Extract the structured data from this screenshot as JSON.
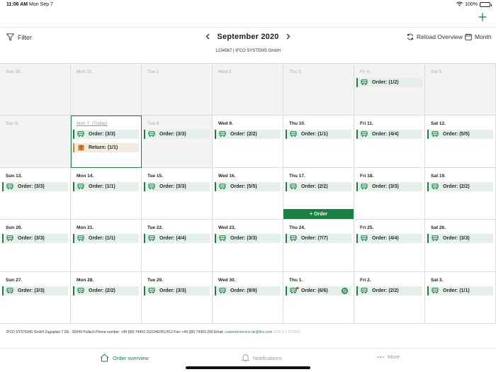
{
  "status_bar": {
    "time": "11:06 AM",
    "date": "Mon Sep 7",
    "battery": "100%"
  },
  "toolbar": {
    "filter_label": "Filter",
    "month_title": "September 2020",
    "customer": "1234567 | IFCO SYSTEMS GmbH",
    "reload_label": "Reload Overview",
    "view_label": "Month"
  },
  "calendar": {
    "cells": [
      {
        "label": "Sun 30.",
        "state": "past",
        "chips": []
      },
      {
        "label": "Mon 31.",
        "state": "past",
        "chips": []
      },
      {
        "label": "Tue 1.",
        "state": "past",
        "chips": []
      },
      {
        "label": "Wed 2.",
        "state": "past",
        "chips": []
      },
      {
        "label": "Thu 3.",
        "state": "past",
        "chips": []
      },
      {
        "label": "Fri 4.",
        "state": "past",
        "chips": [
          {
            "type": "order",
            "text": "Order: (1/2)"
          }
        ]
      },
      {
        "label": "Sat 5.",
        "state": "past",
        "chips": []
      },
      {
        "label": "Sun 6.",
        "state": "past",
        "chips": []
      },
      {
        "label": "Mon 7. (Today)",
        "state": "today",
        "chips": [
          {
            "type": "order",
            "text": "Order: (3/3)"
          },
          {
            "type": "return",
            "text": "Return: (1/1)"
          }
        ]
      },
      {
        "label": "Tue 8.",
        "state": "past",
        "chips": [
          {
            "type": "order",
            "text": "Order: (3/3)"
          }
        ]
      },
      {
        "label": "Wed 9.",
        "state": "",
        "chips": [
          {
            "type": "order",
            "text": "Order: (2/2)"
          }
        ]
      },
      {
        "label": "Thu 10.",
        "state": "",
        "chips": [
          {
            "type": "order",
            "text": "Order: (1/1)"
          }
        ]
      },
      {
        "label": "Fri 11.",
        "state": "",
        "chips": [
          {
            "type": "order",
            "text": "Order: (4/4)"
          }
        ]
      },
      {
        "label": "Sat 12.",
        "state": "",
        "chips": [
          {
            "type": "order",
            "text": "Order: (5/5)"
          }
        ]
      },
      {
        "label": "Sun 13.",
        "state": "",
        "chips": [
          {
            "type": "order",
            "text": "Order: (3/3)"
          }
        ]
      },
      {
        "label": "Mon 14.",
        "state": "",
        "chips": [
          {
            "type": "order",
            "text": "Order: (1/1)"
          }
        ]
      },
      {
        "label": "Tue 15.",
        "state": "",
        "chips": [
          {
            "type": "order",
            "text": "Order: (3/3)"
          }
        ]
      },
      {
        "label": "Wed 16.",
        "state": "",
        "chips": [
          {
            "type": "order",
            "text": "Order: (5/5)"
          }
        ]
      },
      {
        "label": "Thu 17.",
        "state": "",
        "chips": [
          {
            "type": "order",
            "text": "Order: (2/2)"
          }
        ],
        "add_button": "+ Order"
      },
      {
        "label": "Fri 18.",
        "state": "",
        "chips": [
          {
            "type": "order",
            "text": "Order: (3/3)"
          }
        ]
      },
      {
        "label": "Sat 19.",
        "state": "",
        "chips": [
          {
            "type": "order",
            "text": "Order: (2/2)"
          }
        ]
      },
      {
        "label": "Sun 20.",
        "state": "",
        "chips": [
          {
            "type": "order",
            "text": "Order: (3/3)"
          }
        ]
      },
      {
        "label": "Mon 21.",
        "state": "",
        "chips": [
          {
            "type": "order",
            "text": "Order: (1/1)"
          }
        ]
      },
      {
        "label": "Tue 22.",
        "state": "",
        "chips": [
          {
            "type": "order",
            "text": "Order: (4/4)"
          }
        ]
      },
      {
        "label": "Wed 23.",
        "state": "",
        "chips": [
          {
            "type": "order",
            "text": "Order: (3/3)"
          }
        ]
      },
      {
        "label": "Thu 24.",
        "state": "",
        "chips": [
          {
            "type": "order",
            "text": "Order: (7/7)"
          }
        ]
      },
      {
        "label": "Fri 25.",
        "state": "",
        "chips": [
          {
            "type": "order",
            "text": "Order: (4/4)"
          }
        ]
      },
      {
        "label": "Sat 26.",
        "state": "",
        "chips": [
          {
            "type": "order",
            "text": "Order: (3/3)"
          }
        ]
      },
      {
        "label": "Sun 27.",
        "state": "",
        "chips": [
          {
            "type": "order",
            "text": "Order: (3/3)"
          }
        ]
      },
      {
        "label": "Mon 28.",
        "state": "",
        "chips": [
          {
            "type": "order",
            "text": "Order: (2/2)"
          }
        ]
      },
      {
        "label": "Tue 29.",
        "state": "",
        "chips": [
          {
            "type": "order",
            "text": "Order: (3/3)"
          }
        ]
      },
      {
        "label": "Wed 30.",
        "state": "",
        "chips": [
          {
            "type": "order",
            "text": "Order: (9/9)"
          }
        ]
      },
      {
        "label": "Thu 1.",
        "state": "",
        "chips": [
          {
            "type": "order",
            "text": "Order: (6/6)",
            "flag": true,
            "badge": true
          }
        ]
      },
      {
        "label": "Fri 2.",
        "state": "",
        "chips": [
          {
            "type": "order",
            "text": "Order: (2/2)"
          }
        ]
      },
      {
        "label": "Sat 3.",
        "state": "",
        "chips": [
          {
            "type": "order",
            "text": "Order: (1/1)"
          }
        ]
      }
    ]
  },
  "footer": {
    "info": "IFCO SYSTEMS GmbH Zugspitze 7 DE - 82049 Pullach Phone number: +49 (89) 74491-152/346/351/512 Fax: +49 (89) 74491-290 Email: ",
    "email": "customerservice.de@ifco.com",
    "version": "2020.9.1 (#7026)"
  },
  "tabs": [
    {
      "label": "Order overview",
      "icon": "home-icon",
      "active": true
    },
    {
      "label": "Notifications",
      "icon": "bell-icon",
      "active": false
    },
    {
      "label": "More",
      "icon": "more-icon",
      "active": false
    }
  ],
  "colors": {
    "accent": "#1b7f45",
    "order_chip_bg": "#e6f0eb",
    "return_chip_bg": "#f1ebe1",
    "return_accent": "#d9822b",
    "past_bg": "#f3f3f3"
  },
  "icons": {
    "order": "truck-icon",
    "return": "box-icon",
    "flag": "flag-icon",
    "badge": "ban-icon",
    "reload": "refresh-icon",
    "calendar": "calendar-icon",
    "filter": "filter-icon",
    "add": "plus-icon"
  }
}
